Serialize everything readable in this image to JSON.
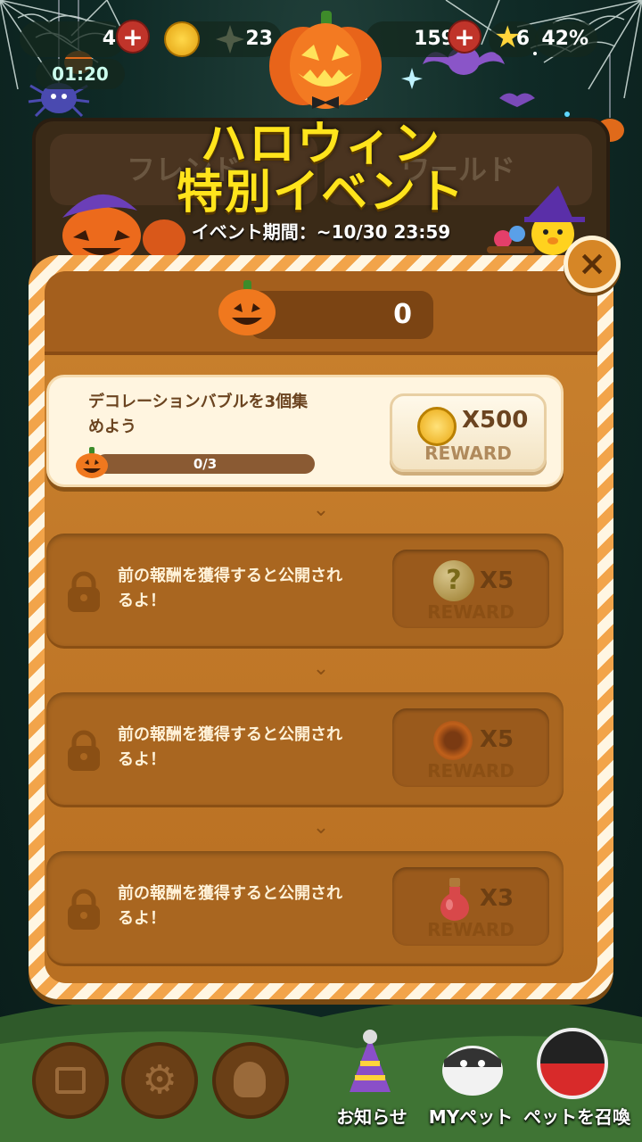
{
  "hud": {
    "lives": "4",
    "timer": "01:20",
    "coins": "23",
    "gems": "159",
    "stars": "6",
    "percent": "42%"
  },
  "back_tabs": {
    "friends": "フレンド",
    "world": "ワールド"
  },
  "event": {
    "title_line1": "ハロウィン",
    "title_line2": "特別イベント",
    "period": "イベント期間：~10/30 23:59"
  },
  "modal": {
    "pumpkin_count": "0",
    "close": "×"
  },
  "missions": [
    {
      "text": "デコレーションバブルを3個集めよう",
      "progress": "0/3",
      "progress_fraction": 0,
      "reward_qty": "X500",
      "reward_label": "REWARD",
      "reward_icon": "coin-icon"
    },
    {
      "text": "前の報酬を獲得すると公開されるよ！",
      "reward_qty": "X5",
      "reward_label": "REWARD",
      "reward_icon": "mystery-bubble-icon"
    },
    {
      "text": "前の報酬を獲得すると公開されるよ！",
      "reward_qty": "X5",
      "reward_label": "REWARD",
      "reward_icon": "fire-bubble-icon"
    },
    {
      "text": "前の報酬を獲得すると公開されるよ！",
      "reward_qty": "X3",
      "reward_label": "REWARD",
      "reward_icon": "potion-icon"
    }
  ],
  "bottom_nav": {
    "notice": "お知らせ",
    "my_pet": "MYペット",
    "summon_pet": "ペットを召喚"
  },
  "colors": {
    "title_yellow": "#ffe41c",
    "panel_orange": "#c9812e",
    "stripe_orange": "#f2a44a"
  }
}
